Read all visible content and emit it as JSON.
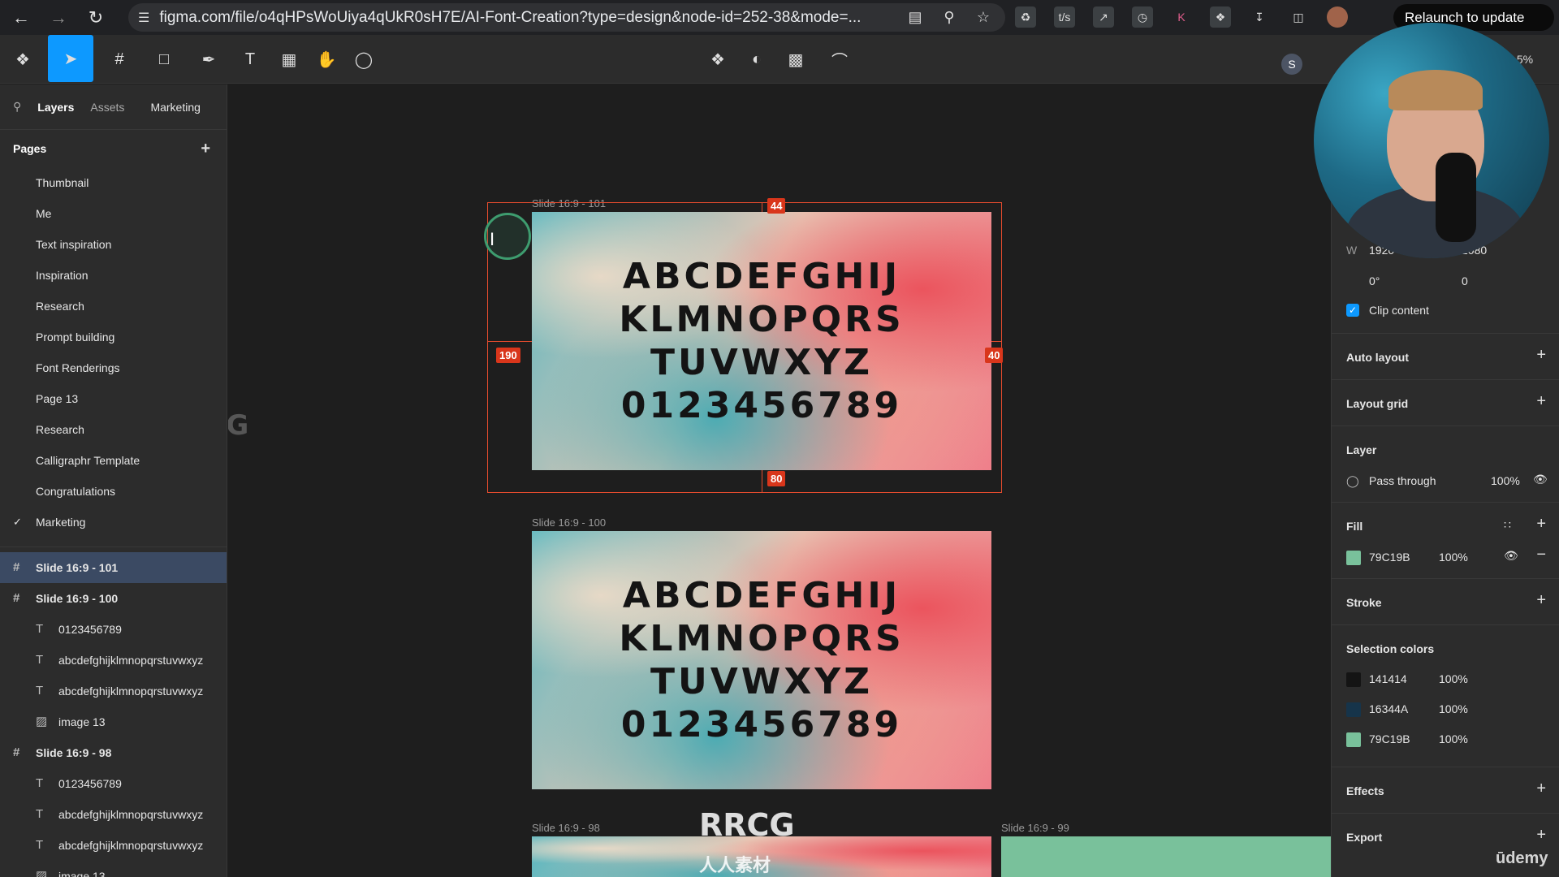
{
  "browser": {
    "url": "figma.com/file/o4qHPsWoUiya4qUkR0sH7E/AI-Font-Creation?type=design&node-id=252-38&mode=...",
    "relaunch_label": "Relaunch to update",
    "ext_labels": [
      "t/s",
      "K"
    ]
  },
  "toolbar": {
    "avatar_initial": "S",
    "zoom": "5%"
  },
  "left_panel": {
    "tabs": [
      "Layers",
      "Assets",
      "Marketing"
    ],
    "pages_title": "Pages",
    "pages": [
      "Thumbnail",
      "Me",
      "Text inspiration",
      "Inspiration",
      "Research",
      "Prompt building",
      "Font Renderings",
      "Page 13",
      "Research",
      "Calligraphr Template",
      "Congratulations",
      "Marketing"
    ],
    "layers": [
      {
        "label": "Slide 16:9 - 101",
        "type": "frame"
      },
      {
        "label": "Slide 16:9 - 100",
        "type": "frame"
      },
      {
        "label": "0123456789",
        "type": "text"
      },
      {
        "label": "abcdefghijklmnopqrstuvwxyz",
        "type": "text"
      },
      {
        "label": "abcdefghijklmnopqrstuvwxyz",
        "type": "text"
      },
      {
        "label": "image 13",
        "type": "image"
      },
      {
        "label": "Slide 16:9 - 98",
        "type": "frame"
      },
      {
        "label": "0123456789",
        "type": "text"
      },
      {
        "label": "abcdefghijklmnopqrstuvwxyz",
        "type": "text"
      },
      {
        "label": "abcdefghijklmnopqrstuvwxyz",
        "type": "text"
      },
      {
        "label": "image 13",
        "type": "image"
      }
    ]
  },
  "canvas": {
    "frame_labels": [
      "Slide 16:9 - 101",
      "Slide 16:9 - 100",
      "Slide 16:9 - 98",
      "Slide 16:9 - 99"
    ],
    "slide_lines": [
      "ABCDEFGHIJ",
      "KLMNOPQRS",
      "TUVWXYZ",
      "0123456789"
    ],
    "measures": {
      "top": "44",
      "left": "190",
      "right": "40",
      "bottom": "80"
    },
    "watermark": "RRCG",
    "watermark_sub": "人人素材"
  },
  "right_panel": {
    "w_label": "W",
    "w_value": "1920",
    "h_value": "1080",
    "rotation": "0°",
    "radius": "0",
    "clip_content": "Clip content",
    "auto_layout": "Auto layout",
    "layout_grid": "Layout grid",
    "layer_title": "Layer",
    "blend_mode": "Pass through",
    "layer_opacity": "100%",
    "fill_title": "Fill",
    "fill_hex": "79C19B",
    "fill_opacity": "100%",
    "stroke_title": "Stroke",
    "selection_colors_title": "Selection colors",
    "selection_colors": [
      {
        "hex": "141414",
        "opacity": "100%",
        "color": "#141414"
      },
      {
        "hex": "16344A",
        "opacity": "100%",
        "color": "#16344A"
      },
      {
        "hex": "79C19B",
        "opacity": "100%",
        "color": "#79C19B"
      }
    ],
    "effects_title": "Effects",
    "export_title": "Export"
  },
  "overlay": {
    "udemy": "ūdemy"
  },
  "colors": {
    "accent": "#0d99ff",
    "selection": "#e24b2e",
    "fill": "#79C19B"
  }
}
